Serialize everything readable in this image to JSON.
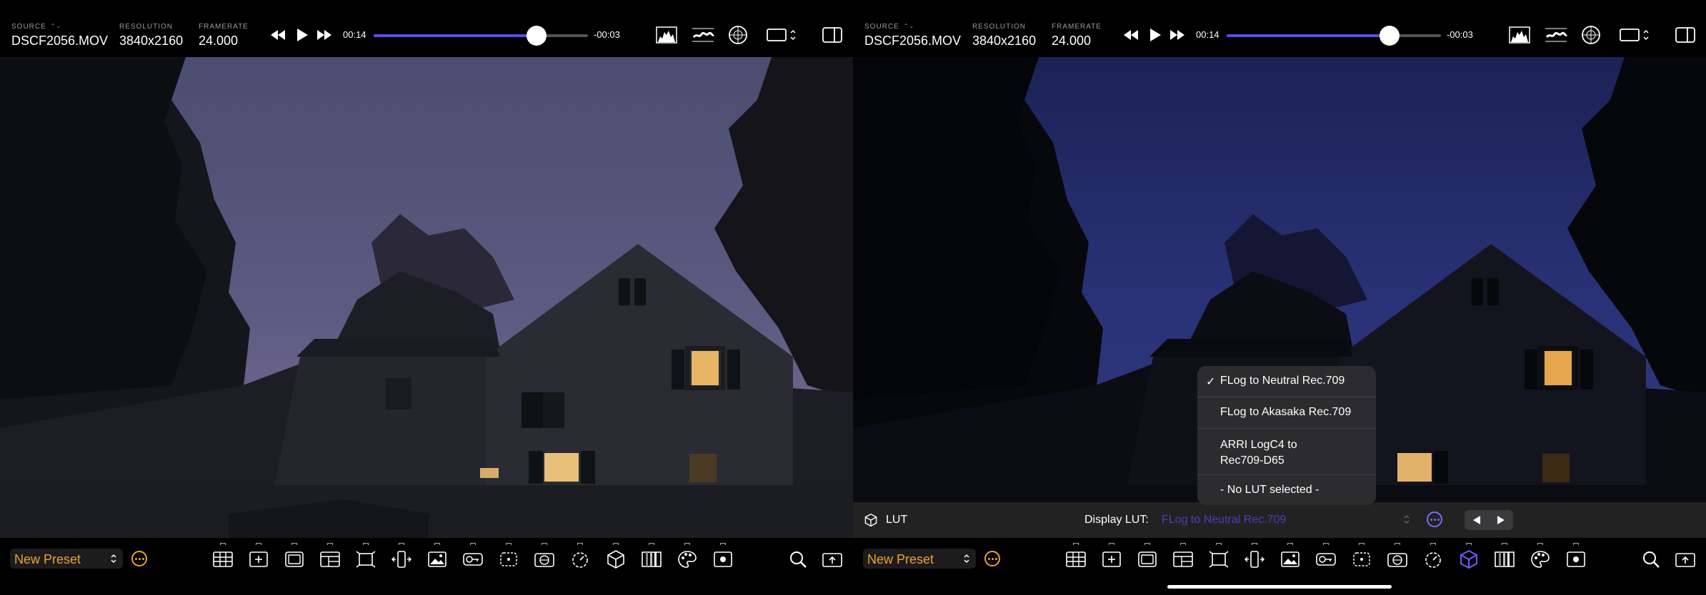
{
  "left_pane": {
    "source": {
      "label": "SOURCE",
      "value": "DSCF2056.MOV"
    },
    "resolution": {
      "label": "RESOLUTION",
      "value": "3840x2160"
    },
    "framerate": {
      "label": "FRAMERATE",
      "value": "24.000"
    },
    "elapsed": "00:14",
    "remaining": "-00:03",
    "progress_fraction": 0.76,
    "preset": "New Preset"
  },
  "right_pane": {
    "source": {
      "label": "SOURCE",
      "value": "DSCF2056.MOV"
    },
    "resolution": {
      "label": "RESOLUTION",
      "value": "3840x2160"
    },
    "framerate": {
      "label": "FRAMERATE",
      "value": "24.000"
    },
    "elapsed": "00:14",
    "remaining": "-00:03",
    "progress_fraction": 0.76,
    "preset": "New Preset",
    "lut_panel": {
      "title": "LUT",
      "display_label": "Display LUT:",
      "selected": "FLog to Neutral Rec.709"
    },
    "lut_menu": {
      "items": [
        {
          "label": "FLog to Neutral Rec.709",
          "checked": true
        },
        {
          "label": "FLog to Akasaka Rec.709",
          "checked": false
        },
        {
          "label": "ARRI LogC4 to Rec709-D65",
          "checked": false
        },
        {
          "label": "- No LUT selected -",
          "checked": false
        }
      ]
    }
  },
  "toolbar_tools": [
    "grid-tool",
    "add-tool",
    "frame-tool",
    "layout-tool",
    "crop-tool",
    "flip-tool",
    "image-tool",
    "key-tool",
    "focus-tool",
    "camera-tool",
    "timer-tool",
    "lut-cube-tool",
    "histogram-tool",
    "palette-tool",
    "record-tool"
  ],
  "colors": {
    "accent_orange": "#f0a030",
    "accent_purple": "#5b4cf5",
    "lut_active": "#7a6cff",
    "menu_bg": "#2c2c2e"
  }
}
